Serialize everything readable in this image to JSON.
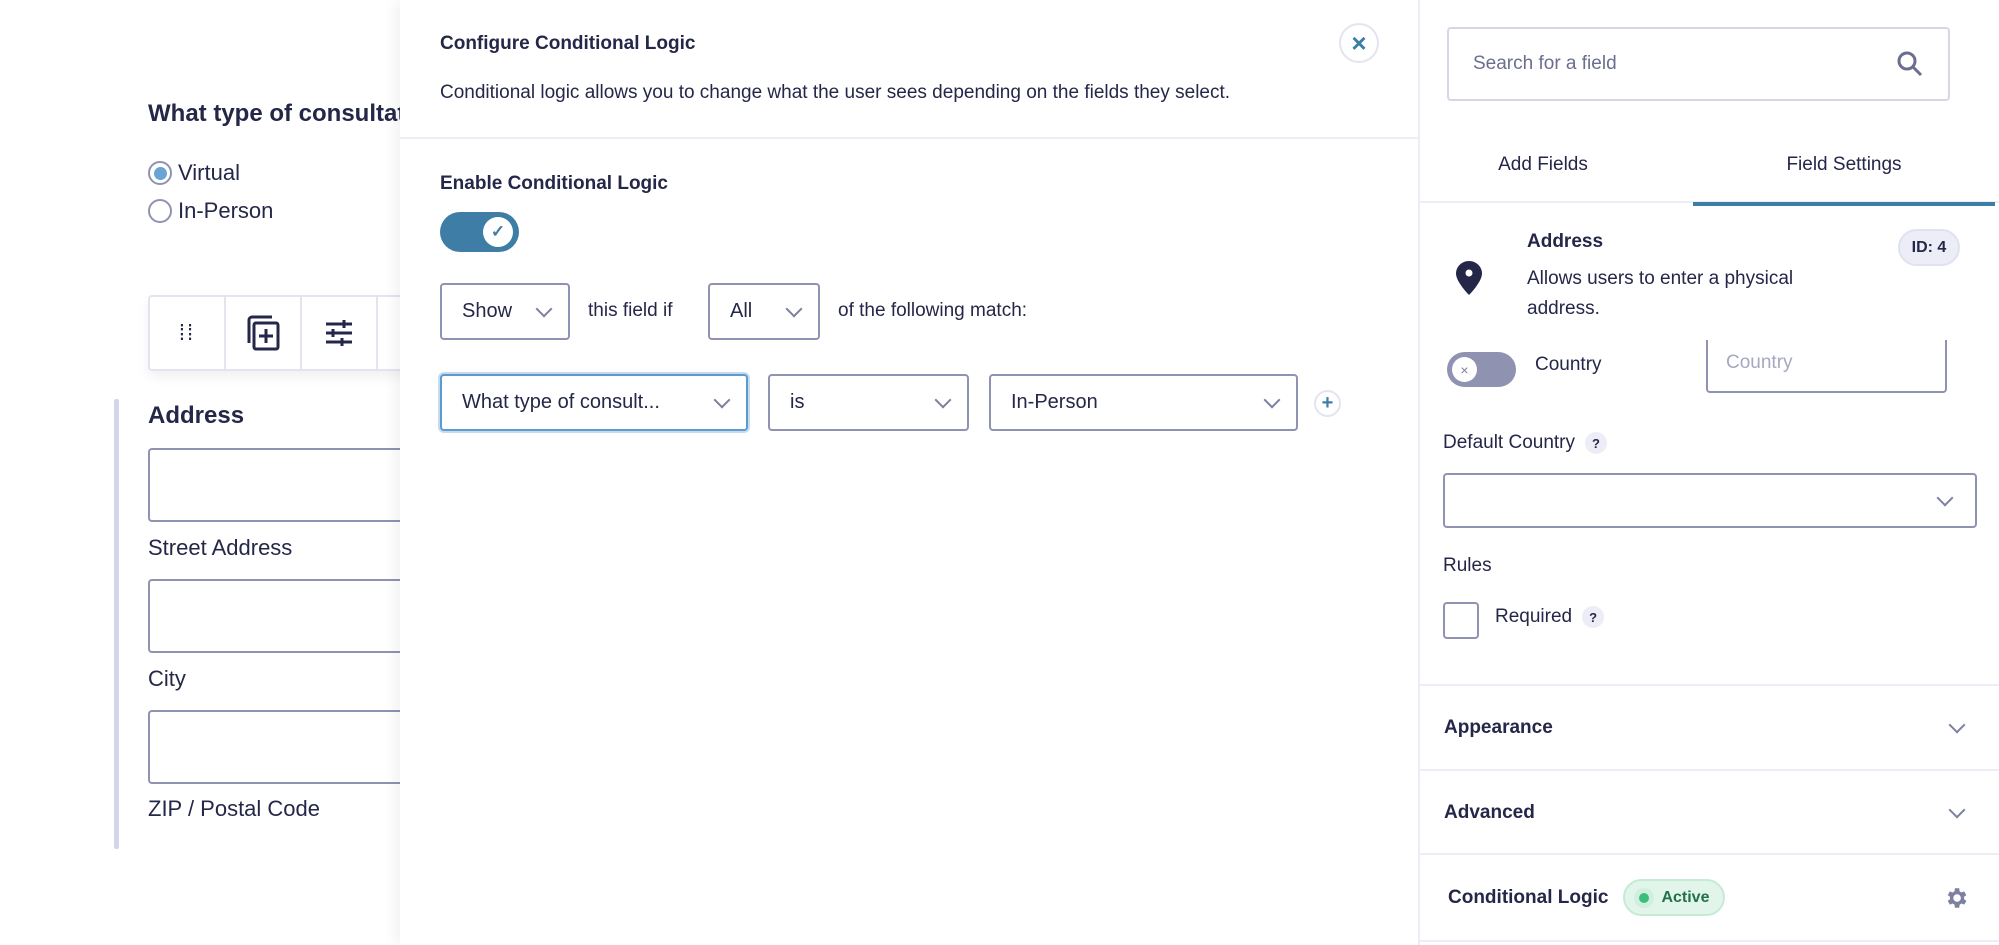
{
  "form": {
    "question": "What type of consultation?",
    "options": [
      {
        "label": "Virtual",
        "selected": true
      },
      {
        "label": "In-Person",
        "selected": false
      }
    ],
    "address_label": "Address",
    "sub_labels": [
      "Street Address",
      "City",
      "ZIP / Postal Code"
    ],
    "toolbar_icons": [
      "drag-handle-icon",
      "duplicate-icon",
      "settings-sliders-icon"
    ]
  },
  "modal": {
    "title": "Configure Conditional Logic",
    "description": "Conditional logic allows you to change what the user sees depending on the fields they select.",
    "enable_label": "Enable Conditional Logic",
    "enabled": true,
    "action": "Show",
    "text_field_if": "this field if",
    "match": "All",
    "text_following": "of the following match:",
    "rule": {
      "field": "What type of consult...",
      "operator": "is",
      "value": "In-Person"
    },
    "accent": "#3e7da6"
  },
  "sidebar": {
    "search_placeholder": "Search for a field",
    "tabs": [
      {
        "label": "Add Fields",
        "active": false
      },
      {
        "label": "Field Settings",
        "active": true
      }
    ],
    "field": {
      "title": "Address",
      "description_line1": "Allows users to enter a physical",
      "description_line2": "address.",
      "id_badge": "ID: 4"
    },
    "country_toggle_label": "Country",
    "country_toggle_on": false,
    "country_placeholder": "Country",
    "default_country_label": "Default Country",
    "default_country_value": "",
    "help": "?",
    "rules_label": "Rules",
    "required_label": "Required",
    "required_checked": false,
    "sections": [
      "Appearance",
      "Advanced"
    ],
    "conditional_logic_label": "Conditional Logic",
    "conditional_status": "Active",
    "status_color": "#3ebd7a"
  }
}
